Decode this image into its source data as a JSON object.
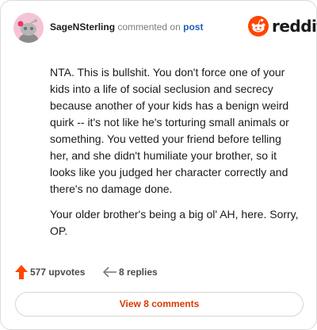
{
  "header": {
    "username": "SageNSterling",
    "action_text": "commented on",
    "post_link": "post",
    "brand_name": "reddit"
  },
  "comment": {
    "paragraphs": [
      "NTA. This is bullshit. You don't force one of your kids into a life of social seclusion and secrecy because another of your kids has a benign weird quirk -- it's not like he's torturing small animals or something. You vetted your friend before telling her, and she didn't humiliate your brother, so it looks like you judged her character correctly and there's no damage done.",
      "Your older brother's being a big ol' AH, here. Sorry, OP."
    ]
  },
  "actions": {
    "upvotes_label": "577 upvotes",
    "replies_label": "8 replies",
    "view_comments_label": "View 8 comments"
  },
  "colors": {
    "brand": "#ff4500",
    "link": "#1f5fb8",
    "view_button_text": "#d93a00",
    "avatar_bg": "#f3c4d6"
  },
  "icons": {
    "avatar": "snoo-avatar-icon",
    "brand": "reddit-logo-icon",
    "upvote": "upvote-arrow-icon",
    "reply": "reply-arrow-icon"
  }
}
